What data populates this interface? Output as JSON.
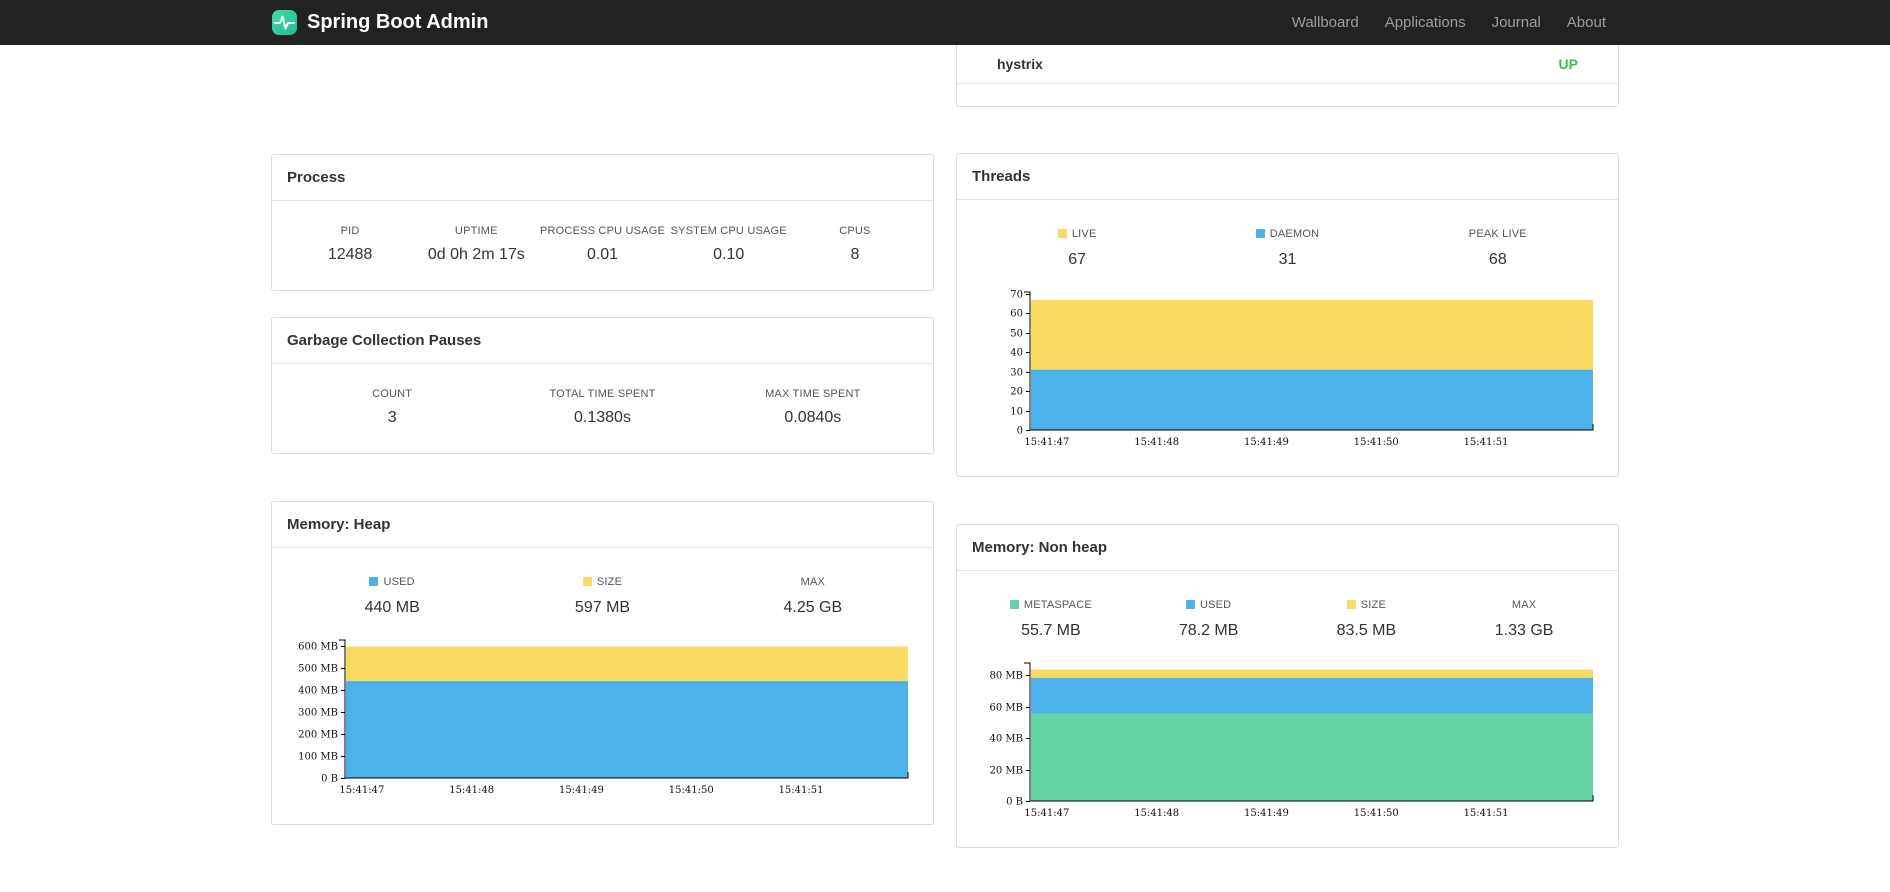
{
  "navbar": {
    "brand": "Spring Boot Admin",
    "links": [
      {
        "label": "Wallboard"
      },
      {
        "label": "Applications"
      },
      {
        "label": "Journal"
      },
      {
        "label": "About"
      }
    ]
  },
  "colors": {
    "accent_teal": "#2BC9A2",
    "status_up": "#3DBE49",
    "series_blue": "#4DB1EC",
    "series_yellow": "#FADB61",
    "series_green": "#65D3A5"
  },
  "health_card": {
    "row": {
      "name": "hystrix",
      "status": "UP"
    }
  },
  "process": {
    "title": "Process",
    "metrics": [
      {
        "label": "PID",
        "value": "12488"
      },
      {
        "label": "UPTIME",
        "value": "0d 0h 2m 17s"
      },
      {
        "label": "PROCESS CPU USAGE",
        "value": "0.01"
      },
      {
        "label": "SYSTEM CPU USAGE",
        "value": "0.10"
      },
      {
        "label": "CPUS",
        "value": "8"
      }
    ]
  },
  "gc": {
    "title": "Garbage Collection Pauses",
    "metrics": [
      {
        "label": "COUNT",
        "value": "3"
      },
      {
        "label": "TOTAL TIME SPENT",
        "value": "0.1380s"
      },
      {
        "label": "MAX TIME SPENT",
        "value": "0.0840s"
      }
    ]
  },
  "threads": {
    "title": "Threads",
    "legend": [
      {
        "label": "LIVE",
        "value": "67",
        "color": "#FADB61"
      },
      {
        "label": "DAEMON",
        "value": "31",
        "color": "#4DB1EC"
      },
      {
        "label": "PEAK LIVE",
        "value": "68",
        "color": null
      }
    ],
    "chart": {
      "type": "area",
      "ymax": 71,
      "ytick_values": [
        0,
        10,
        20,
        30,
        40,
        50,
        60,
        70
      ],
      "ytick_labels": [
        "0",
        "10",
        "20",
        "30",
        "40",
        "50",
        "60",
        "70"
      ],
      "xtick_labels": [
        "15:41:47",
        "15:41:48",
        "15:41:49",
        "15:41:50",
        "15:41:51"
      ],
      "series": [
        {
          "name": "daemon",
          "color": "#4DB1EC",
          "value": 31
        },
        {
          "name": "live",
          "color": "#FADB61",
          "value": 67
        }
      ]
    }
  },
  "heap": {
    "title": "Memory: Heap",
    "legend": [
      {
        "label": "USED",
        "value": "440 MB",
        "color": "#4DB1EC"
      },
      {
        "label": "SIZE",
        "value": "597 MB",
        "color": "#FADB61"
      },
      {
        "label": "MAX",
        "value": "4.25 GB",
        "color": null
      }
    ],
    "chart": {
      "type": "area",
      "ymax": 627,
      "ytick_values": [
        0,
        100,
        200,
        300,
        400,
        500,
        600
      ],
      "ytick_labels": [
        "0 B",
        "100 MB",
        "200 MB",
        "300 MB",
        "400 MB",
        "500 MB",
        "600 MB"
      ],
      "xtick_labels": [
        "15:41:47",
        "15:41:48",
        "15:41:49",
        "15:41:50",
        "15:41:51"
      ],
      "series": [
        {
          "name": "used",
          "color": "#4DB1EC",
          "value": 440
        },
        {
          "name": "size",
          "color": "#FADB61",
          "value": 597
        }
      ]
    }
  },
  "nonheap": {
    "title": "Memory: Non heap",
    "legend": [
      {
        "label": "METASPACE",
        "value": "55.7 MB",
        "color": "#65D3A5"
      },
      {
        "label": "USED",
        "value": "78.2 MB",
        "color": "#4DB1EC"
      },
      {
        "label": "SIZE",
        "value": "83.5 MB",
        "color": "#FADB61"
      },
      {
        "label": "MAX",
        "value": "1.33 GB",
        "color": null
      }
    ],
    "chart": {
      "type": "area",
      "ymax": 87.7,
      "ytick_values": [
        0,
        20,
        40,
        60,
        80
      ],
      "ytick_labels": [
        "0 B",
        "20 MB",
        "40 MB",
        "60 MB",
        "80 MB"
      ],
      "xtick_labels": [
        "15:41:47",
        "15:41:48",
        "15:41:49",
        "15:41:50",
        "15:41:51"
      ],
      "series": [
        {
          "name": "metaspace",
          "color": "#65D3A5",
          "value": 55.7
        },
        {
          "name": "used",
          "color": "#4DB1EC",
          "value": 78.2
        },
        {
          "name": "size",
          "color": "#FADB61",
          "value": 83.5
        }
      ]
    }
  }
}
